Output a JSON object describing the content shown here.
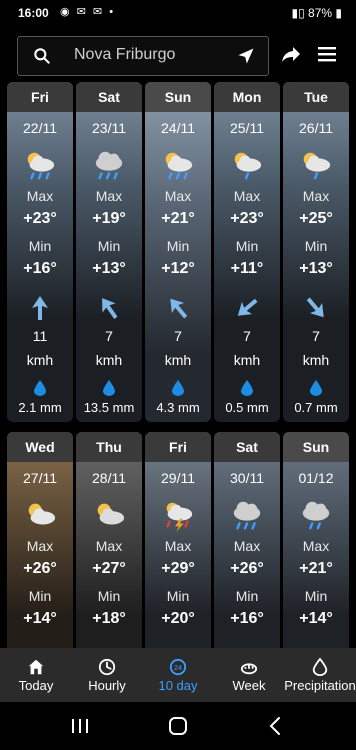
{
  "status": {
    "time": "16:00",
    "battery": "87%"
  },
  "search": {
    "location": "Nova Friburgo"
  },
  "nav": {
    "items": [
      {
        "label": "Today"
      },
      {
        "label": "Hourly"
      },
      {
        "label": "10 day",
        "active": true
      },
      {
        "label": "Week"
      },
      {
        "label": "Precipitation"
      }
    ]
  },
  "units": {
    "max": "Max",
    "min": "Min",
    "wind": "kmh"
  },
  "rows": [
    {
      "days": [
        {
          "day": "Fri",
          "date": "22/11",
          "icon": "partly-cloudy-rain-icon",
          "max": "+23°",
          "min": "+16°",
          "wind": "11",
          "wind_dir": "up-icon",
          "rain": "2.1 mm"
        },
        {
          "day": "Sat",
          "date": "23/11",
          "icon": "cloud-rain-icon",
          "max": "+19°",
          "min": "+13°",
          "wind": "7",
          "wind_dir": "up-left-icon",
          "rain": "13.5 mm"
        },
        {
          "day": "Sun",
          "date": "24/11",
          "icon": "partly-cloudy-rain-icon",
          "max": "+21°",
          "min": "+12°",
          "wind": "7",
          "wind_dir": "up-left-icon",
          "rain": "4.3 mm"
        },
        {
          "day": "Mon",
          "date": "25/11",
          "icon": "partly-cloudy-rain-icon",
          "max": "+23°",
          "min": "+11°",
          "wind": "7",
          "wind_dir": "down-left-icon",
          "rain": "0.5 mm"
        },
        {
          "day": "Tue",
          "date": "26/11",
          "icon": "partly-cloudy-rain-icon",
          "max": "+25°",
          "min": "+13°",
          "wind": "7",
          "wind_dir": "down-right-icon",
          "rain": "0.7 mm"
        }
      ]
    },
    {
      "days": [
        {
          "day": "Wed",
          "date": "27/11",
          "icon": "partly-cloudy-icon",
          "max": "+26°",
          "min": "+14°"
        },
        {
          "day": "Thu",
          "date": "28/11",
          "icon": "partly-cloudy-icon",
          "max": "+27°",
          "min": "+18°"
        },
        {
          "day": "Fri",
          "date": "29/11",
          "icon": "thunderstorm-icon",
          "max": "+29°",
          "min": "+20°"
        },
        {
          "day": "Sat",
          "date": "30/11",
          "icon": "cloud-rain-icon",
          "max": "+26°",
          "min": "+16°"
        },
        {
          "day": "Sun",
          "date": "01/12",
          "icon": "cloud-rain-icon",
          "max": "+21°",
          "min": "+14°"
        }
      ]
    }
  ]
}
